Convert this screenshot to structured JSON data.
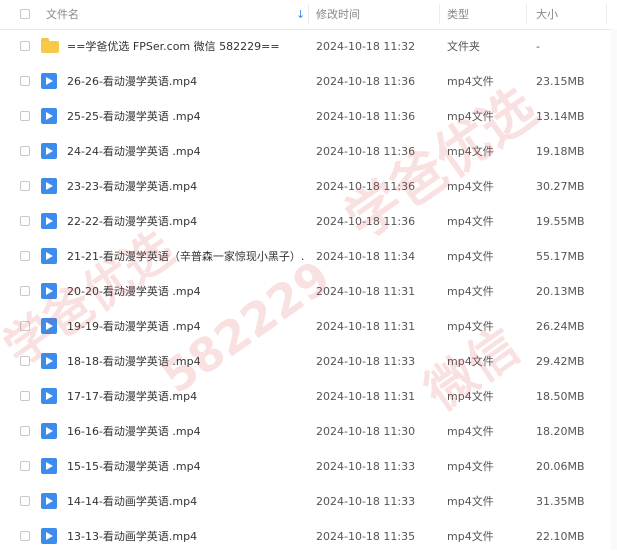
{
  "header": {
    "name": "文件名",
    "sort_arrow": "↓",
    "time": "修改时间",
    "type": "类型",
    "size": "大小"
  },
  "files": [
    {
      "icon": "folder-icon",
      "name": "==学爸优选 FPSer.com 微信 582229==",
      "time": "2024-10-18 11:32",
      "type": "文件夹",
      "size": "-"
    },
    {
      "icon": "video-file-icon",
      "name": "26-26-看动漫学英语.mp4",
      "time": "2024-10-18 11:36",
      "type": "mp4文件",
      "size": "23.15MB"
    },
    {
      "icon": "video-file-icon",
      "name": "25-25-看动漫学英语 .mp4",
      "time": "2024-10-18 11:36",
      "type": "mp4文件",
      "size": "13.14MB"
    },
    {
      "icon": "video-file-icon",
      "name": "24-24-看动漫学英语 .mp4",
      "time": "2024-10-18 11:36",
      "type": "mp4文件",
      "size": "19.18MB"
    },
    {
      "icon": "video-file-icon",
      "name": "23-23-看动漫学英语.mp4",
      "time": "2024-10-18 11:36",
      "type": "mp4文件",
      "size": "30.27MB"
    },
    {
      "icon": "video-file-icon",
      "name": "22-22-看动漫学英语.mp4",
      "time": "2024-10-18 11:36",
      "type": "mp4文件",
      "size": "19.55MB"
    },
    {
      "icon": "video-file-icon",
      "name": "21-21-看动漫学英语（辛普森一家惊现小黑子）....",
      "time": "2024-10-18 11:34",
      "type": "mp4文件",
      "size": "55.17MB"
    },
    {
      "icon": "video-file-icon",
      "name": "20-20-看动漫学英语 .mp4",
      "time": "2024-10-18 11:31",
      "type": "mp4文件",
      "size": "20.13MB"
    },
    {
      "icon": "video-file-icon",
      "name": "19-19-看动漫学英语 .mp4",
      "time": "2024-10-18 11:31",
      "type": "mp4文件",
      "size": "26.24MB"
    },
    {
      "icon": "video-file-icon",
      "name": "18-18-看动漫学英语 .mp4",
      "time": "2024-10-18 11:33",
      "type": "mp4文件",
      "size": "29.42MB"
    },
    {
      "icon": "video-file-icon",
      "name": "17-17-看动漫学英语.mp4",
      "time": "2024-10-18 11:31",
      "type": "mp4文件",
      "size": "18.50MB"
    },
    {
      "icon": "video-file-icon",
      "name": "16-16-看动漫学英语 .mp4",
      "time": "2024-10-18 11:30",
      "type": "mp4文件",
      "size": "18.20MB"
    },
    {
      "icon": "video-file-icon",
      "name": "15-15-看动漫学英语 .mp4",
      "time": "2024-10-18 11:33",
      "type": "mp4文件",
      "size": "20.06MB"
    },
    {
      "icon": "video-file-icon",
      "name": "14-14-看动画学英语.mp4",
      "time": "2024-10-18 11:33",
      "type": "mp4文件",
      "size": "31.35MB"
    },
    {
      "icon": "video-file-icon",
      "name": "13-13-看动画学英语.mp4",
      "time": "2024-10-18 11:35",
      "type": "mp4文件",
      "size": "22.10MB"
    }
  ],
  "watermark": {
    "text_a": "学爸优选",
    "text_b": "582229",
    "text_c": "微信"
  }
}
